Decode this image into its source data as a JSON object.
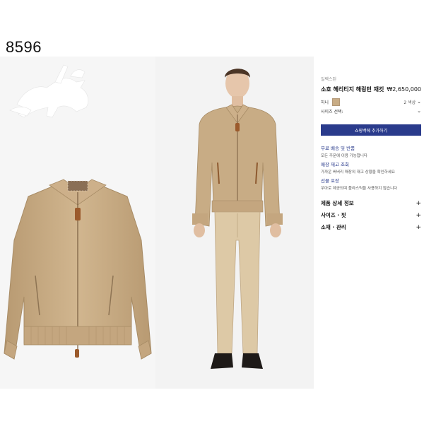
{
  "code_label": "8596",
  "product": {
    "breadcrumb": "일렉스된",
    "name": "소호 헤리티지 해링턴 재킷",
    "price": "₩2,650,000",
    "color_label": "허니",
    "color_hex": "#c8ac85",
    "swatch_count": "2 색상",
    "size_label": "사이즈 선택:",
    "cart_button": "쇼핑백에 추가하기"
  },
  "services": [
    {
      "title": "무료 배송 및 반품",
      "desc": "모든 주문에 이용 가능합니다"
    },
    {
      "title": "매장 재고 조회",
      "desc": "가까운 버버리 매장의 재고 상황을 확인하세요"
    },
    {
      "title": "선물 포장",
      "desc": "우아로 제공되며 플라스틱을 사용하지 않습니다"
    }
  ],
  "accordion": [
    {
      "label": "제품 상세 정보",
      "icon": "plus-icon"
    },
    {
      "label": "사이즈 · 핏",
      "icon": "plus-icon"
    },
    {
      "label": "소재 · 관리",
      "icon": "plus-icon"
    }
  ],
  "colors": {
    "accent": "#2a3b8c",
    "jacket": "#c8ac85",
    "trousers": "#ddc9a6"
  }
}
